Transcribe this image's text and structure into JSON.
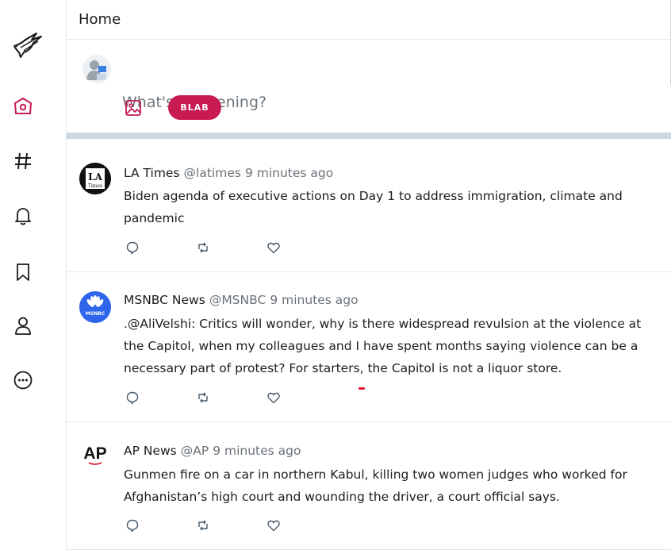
{
  "header": {
    "title": "Home"
  },
  "composer": {
    "placeholder": "What's happening?",
    "submit_label": "BLAB"
  },
  "sidebar": {
    "items": [
      {
        "name": "logo",
        "icon": "bird-logo-icon"
      },
      {
        "name": "home",
        "icon": "home-icon",
        "active": true
      },
      {
        "name": "explore",
        "icon": "hashtag-icon"
      },
      {
        "name": "notifications",
        "icon": "bell-icon"
      },
      {
        "name": "bookmarks",
        "icon": "bookmark-icon"
      },
      {
        "name": "profile",
        "icon": "user-icon"
      },
      {
        "name": "more",
        "icon": "more-circle-icon"
      }
    ],
    "accent_color": "#c71b52"
  },
  "posts": [
    {
      "name": "LA Times",
      "handle": "@latimes",
      "time": "9 minutes ago",
      "avatar_text": "LA Times",
      "text": "Biden agenda of executive actions on Day 1 to address immigration, climate and pandemic"
    },
    {
      "name": "MSNBC News",
      "handle": "@MSNBC",
      "time": "9 minutes ago",
      "avatar_text": "MSNBC",
      "text": ".@AliVelshi: Critics will wonder, why is there widespread revulsion at the violence at the Capitol, when my colleagues and I have spent months saying violence can be a necessary part of protest? For starters, the Capitol is not a liquor store."
    },
    {
      "name": "AP News",
      "handle": "@AP",
      "time": "9 minutes ago",
      "avatar_text": "AP",
      "text": "Gunmen fire on a car in northern Kabul, killing two women judges who worked for Afghanistan’s high court and wounding the driver, a court official says."
    }
  ]
}
